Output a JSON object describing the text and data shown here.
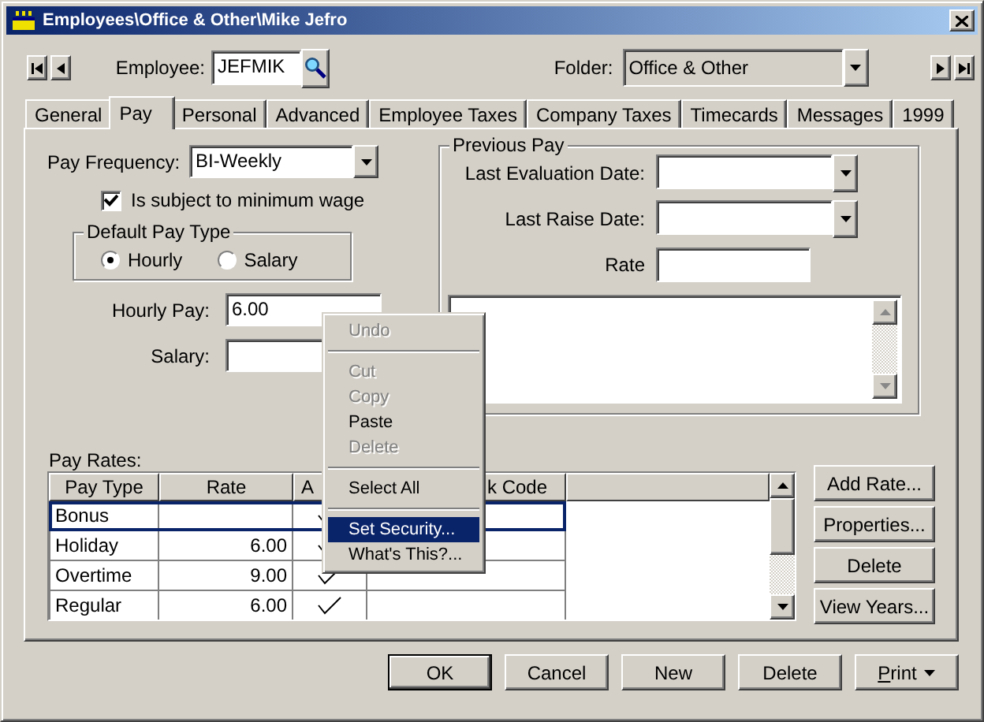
{
  "window": {
    "title": "Employees\\Office & Other\\Mike Jefro"
  },
  "employee": {
    "label": "Employee:",
    "value": "JEFMIK"
  },
  "folder": {
    "label": "Folder:",
    "value": "Office & Other"
  },
  "tabs": [
    {
      "label": "General",
      "selected": false
    },
    {
      "label": "Pay",
      "selected": true
    },
    {
      "label": "Personal",
      "selected": false
    },
    {
      "label": "Advanced",
      "selected": false
    },
    {
      "label": "Employee Taxes",
      "selected": false
    },
    {
      "label": "Company Taxes",
      "selected": false
    },
    {
      "label": "Timecards",
      "selected": false
    },
    {
      "label": "Messages",
      "selected": false
    },
    {
      "label": "1999",
      "selected": false
    }
  ],
  "pay_frequency": {
    "label": "Pay Frequency:",
    "value": "BI-Weekly"
  },
  "minimum_wage": {
    "label": "Is subject to minimum wage",
    "checked": true
  },
  "default_pay_type": {
    "title": "Default Pay Type",
    "options": [
      {
        "label": "Hourly",
        "selected": true
      },
      {
        "label": "Salary",
        "selected": false
      }
    ]
  },
  "hourly_pay": {
    "label": "Hourly Pay:",
    "value": "6.00"
  },
  "salary": {
    "label": "Salary:"
  },
  "previous_pay": {
    "title": "Previous Pay",
    "fields": [
      {
        "label": "Last Evaluation Date:",
        "kind": "date"
      },
      {
        "label": "Last Raise Date:",
        "kind": "date"
      },
      {
        "label": "Rate",
        "kind": "text"
      }
    ]
  },
  "pay_rates": {
    "label": "Pay Rates:",
    "columns": [
      "Pay Type",
      "Rate",
      "A",
      "k Code"
    ],
    "rows": [
      {
        "pay_type": "Bonus",
        "rate": "",
        "active": true,
        "selected": true
      },
      {
        "pay_type": "Holiday",
        "rate": "6.00",
        "active": true,
        "selected": false
      },
      {
        "pay_type": "Overtime",
        "rate": "9.00",
        "active": true,
        "selected": false
      },
      {
        "pay_type": "Regular",
        "rate": "6.00",
        "active": true,
        "selected": false
      }
    ]
  },
  "side_buttons": [
    "Add Rate...",
    "Properties...",
    "Delete",
    "View Years..."
  ],
  "buttons": [
    {
      "label": "OK",
      "kind": "default"
    },
    {
      "label": "Cancel",
      "kind": "plain"
    },
    {
      "label": "New",
      "kind": "plain"
    },
    {
      "label": "Delete",
      "kind": "plain"
    },
    {
      "label": "Print",
      "kind": "menu"
    }
  ],
  "context_menu": [
    {
      "kind": "item",
      "label": "Undo",
      "disabled": true,
      "selected": false
    },
    {
      "kind": "separator"
    },
    {
      "kind": "item",
      "label": "Cut",
      "disabled": true,
      "selected": false
    },
    {
      "kind": "item",
      "label": "Copy",
      "disabled": true,
      "selected": false
    },
    {
      "kind": "item",
      "label": "Paste",
      "disabled": false,
      "selected": false
    },
    {
      "kind": "item",
      "label": "Delete",
      "disabled": true,
      "selected": false
    },
    {
      "kind": "separator"
    },
    {
      "kind": "item",
      "label": "Select All",
      "disabled": false,
      "selected": false
    },
    {
      "kind": "separator"
    },
    {
      "kind": "item",
      "label": "Set Security...",
      "disabled": false,
      "selected": true
    },
    {
      "kind": "item",
      "label": "What's This?...",
      "disabled": false,
      "selected": false
    }
  ]
}
